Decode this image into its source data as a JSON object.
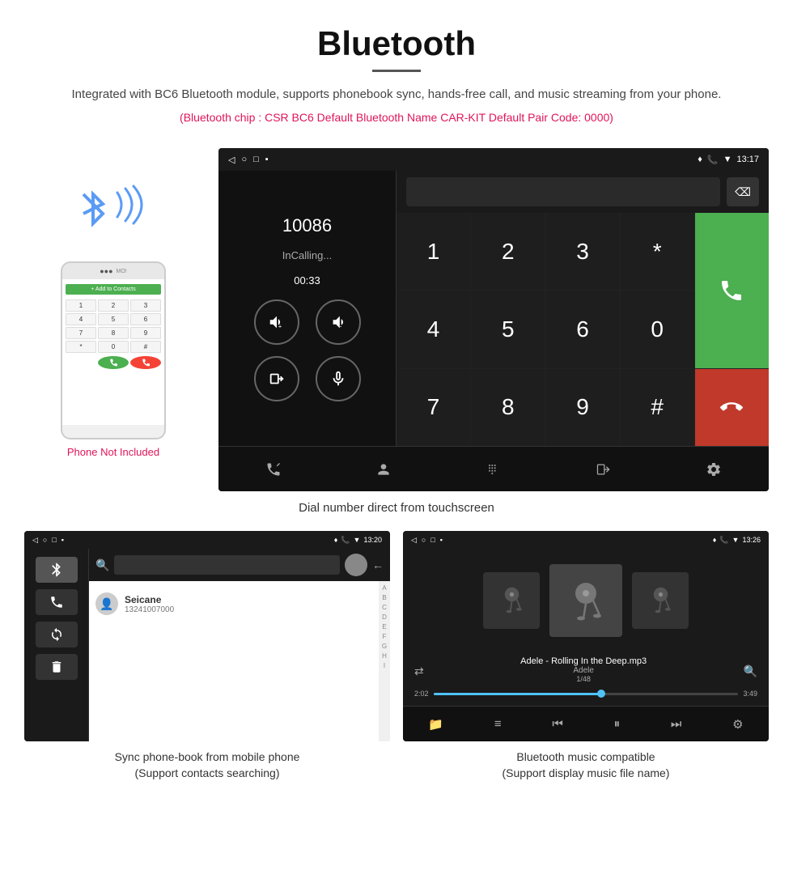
{
  "header": {
    "title": "Bluetooth",
    "description": "Integrated with BC6 Bluetooth module, supports phonebook sync, hands-free call, and music streaming from your phone.",
    "specs": "(Bluetooth chip : CSR BC6    Default Bluetooth Name CAR-KIT    Default Pair Code: 0000)"
  },
  "phone_side": {
    "not_included": "Phone Not Included"
  },
  "main_screenshot": {
    "status_bar": {
      "time": "13:17",
      "icons_left": [
        "◁",
        "○",
        "□",
        "▪"
      ]
    },
    "call_number": "10086",
    "call_status": "InCalling...",
    "call_timer": "00:33",
    "keypad": [
      "1",
      "2",
      "3",
      "4",
      "5",
      "6",
      "7",
      "8",
      "9",
      "*",
      "0",
      "#"
    ],
    "caption": "Dial number direct from touchscreen"
  },
  "phonebook_screenshot": {
    "status_bar": {
      "time": "13:20"
    },
    "contact": {
      "name": "Seicane",
      "number": "13241007000"
    },
    "alphabet": [
      "A",
      "B",
      "C",
      "D",
      "E",
      "F",
      "G",
      "H",
      "I"
    ],
    "caption_line1": "Sync phone-book from mobile phone",
    "caption_line2": "(Support contacts searching)"
  },
  "music_screenshot": {
    "status_bar": {
      "time": "13:26"
    },
    "track_title": "Adele - Rolling In the Deep.mp3",
    "artist": "Adele",
    "track_num": "1/48",
    "time_current": "2:02",
    "time_total": "3:49",
    "progress_percent": 55,
    "caption_line1": "Bluetooth music compatible",
    "caption_line2": "(Support display music file name)"
  },
  "icons": {
    "bluetooth": "✦",
    "phone": "📞",
    "music_note": "♪",
    "volume_up": "🔊",
    "volume_down": "🔉",
    "transfer": "📤",
    "mic": "🎤",
    "call": "📞",
    "end_call": "📵",
    "contacts": "👤",
    "keypad": "⌨",
    "settings": "⚙",
    "shuffle": "⇄",
    "search": "🔍",
    "folder": "📁",
    "list": "≡",
    "prev": "⏮",
    "play_pause": "⏸",
    "next": "⏭",
    "equalizer": "⚙"
  }
}
